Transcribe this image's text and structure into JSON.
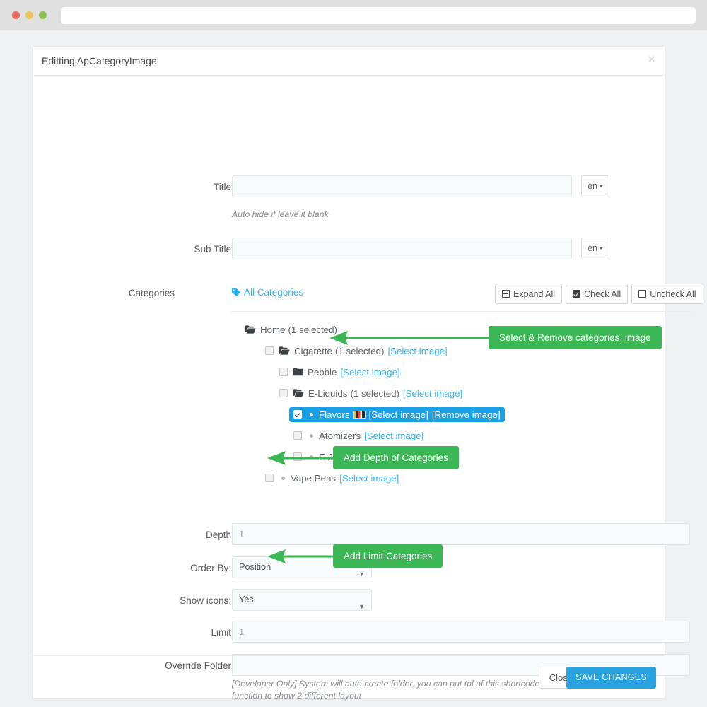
{
  "browser": {
    "url_value": "",
    "url_placeholder": "",
    "dots": [
      "red",
      "yellow",
      "green"
    ]
  },
  "modal": {
    "title": "Editting ApCategoryImage",
    "close_icon": "close-icon"
  },
  "form": {
    "title_field": {
      "label": "Title",
      "value": "",
      "placeholder": "",
      "lang": "en",
      "helper": "Auto hide if leave it blank"
    },
    "subtitle_field": {
      "label": "Sub Title",
      "value": "",
      "placeholder": "",
      "lang": "en"
    },
    "categories": {
      "label": "Categories",
      "all_categories_link": "All Categories",
      "tag_icon": "tag-icon",
      "buttons": [
        {
          "label": "Expand All",
          "icon": "plus-square-icon"
        },
        {
          "label": "Check All",
          "icon": "checked-square-icon"
        },
        {
          "label": "Uncheck All",
          "icon": "empty-square-icon"
        }
      ],
      "tree": [
        {
          "name": "Home",
          "suffix": "(1 selected)",
          "icon": "folder-open-icon",
          "indent": 0,
          "checkbox": null,
          "links": []
        },
        {
          "name": "Cigarette",
          "suffix": "(1 selected)",
          "icon": "folder-open-icon",
          "indent": 1,
          "checkbox": "unchecked",
          "links": [
            "[Select image]"
          ]
        },
        {
          "name": "Pebble",
          "suffix": "",
          "icon": "folder-closed-icon",
          "indent": 2,
          "checkbox": "unchecked",
          "links": [
            "[Select image]"
          ]
        },
        {
          "name": "E-Liquids",
          "suffix": "(1 selected)",
          "icon": "folder-open-icon",
          "indent": 2,
          "checkbox": "unchecked",
          "links": [
            "[Select image]"
          ]
        },
        {
          "name": "Flavors",
          "suffix": "",
          "icon": "bullet-icon",
          "indent": 3,
          "checkbox": "checked",
          "selected": true,
          "thumbnail": "category-thumbnail-image",
          "links": [
            "[Select image]",
            "[Remove image]"
          ]
        },
        {
          "name": "Atomizers",
          "suffix": "",
          "icon": "bullet-icon",
          "indent": 3,
          "checkbox": "unchecked",
          "links": [
            "[Select image]"
          ]
        },
        {
          "name": "E-Juice",
          "suffix": "",
          "icon": "bullet-icon",
          "indent": 3,
          "checkbox": "unchecked",
          "links": [
            "[Select image]"
          ]
        },
        {
          "name": "Vape Pens",
          "suffix": "",
          "icon": "bullet-icon",
          "indent": 1,
          "checkbox": "unchecked",
          "links": [
            "[Select image]"
          ]
        }
      ]
    },
    "depth_field": {
      "label": "Depth",
      "value": "1",
      "placeholder": ""
    },
    "order_by_field": {
      "label": "Order By:",
      "value": "Position"
    },
    "show_icons_field": {
      "label": "Show icons:",
      "value": "Yes"
    },
    "limit_field": {
      "label": "Limit",
      "value": "1",
      "placeholder": ""
    },
    "override_folder_field": {
      "label": "Override Folder",
      "value": "",
      "placeholder": "",
      "helper": "[Developer Only] System will auto create folder, you can put tpl of this shortcode to the folder. You can use this function to show 2 different layout"
    }
  },
  "callouts": [
    {
      "text": "Select & Remove categories, image"
    },
    {
      "text": "Add Depth of Categories"
    },
    {
      "text": "Add Limit Categories"
    }
  ],
  "footer": {
    "close_label": "Close",
    "save_label": "SAVE CHANGES"
  },
  "colors": {
    "page_bg": "#eff0f2",
    "accent_blue": "#29a3e0",
    "link_blue": "#3ab6ef",
    "selected_row": "#18a0e8",
    "callout_green": "#3cb755",
    "arrow_green": "#3cb755"
  }
}
